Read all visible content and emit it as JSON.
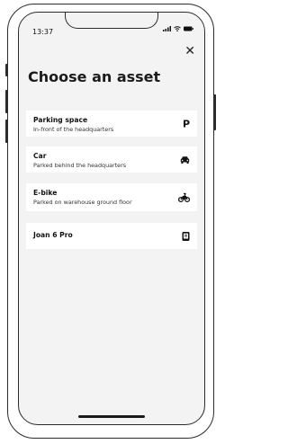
{
  "status": {
    "time": "13:37"
  },
  "header": {
    "title": "Choose an asset"
  },
  "assets": [
    {
      "title": "Parking space",
      "subtitle": "In-front of the headquarters",
      "icon": "parking-icon",
      "icon_text": "P"
    },
    {
      "title": "Car",
      "subtitle": "Parked behind the headquarters",
      "icon": "car-icon"
    },
    {
      "title": "E-bike",
      "subtitle": "Parked on warehouse ground floor",
      "icon": "bike-icon"
    },
    {
      "title": "Joan 6 Pro",
      "subtitle": "",
      "icon": "tablet-icon"
    }
  ]
}
